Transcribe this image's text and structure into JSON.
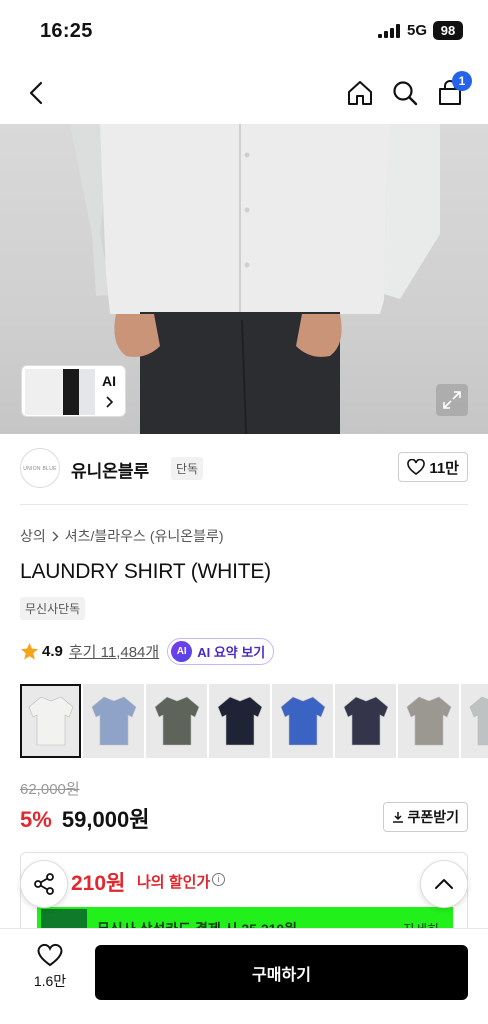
{
  "status_bar": {
    "time": "16:25",
    "network": "5G",
    "battery": "98"
  },
  "nav": {
    "cart_count": "1"
  },
  "hero": {
    "ai_label": "AI"
  },
  "brand": {
    "logo_text": "UNION BLUE",
    "name": "유니온블루",
    "tag": "단독",
    "like_count": "11만"
  },
  "breadcrumb": {
    "level1": "상의",
    "level2": "셔츠/블라우스 (유니온블루)"
  },
  "product": {
    "title": "LAUNDRY SHIRT (WHITE)",
    "exclusive_tag": "무신사단독"
  },
  "rating": {
    "score": "4.9",
    "reviews": "후기 11,484개",
    "ai_badge": "AI",
    "ai_summary": "AI 요약 보기"
  },
  "swatches": [
    {
      "color": "#f2f2f0"
    },
    {
      "color": "#8fa3c8"
    },
    {
      "color": "#5e6459"
    },
    {
      "color": "#1e2335"
    },
    {
      "color": "#3a63c4"
    },
    {
      "color": "#34344a"
    },
    {
      "color": "#9a9891"
    },
    {
      "color": "#bfc2c2"
    }
  ],
  "price": {
    "original": "62,000원",
    "discount": "5%",
    "final": "59,000원",
    "coupon_label": "쿠폰받기"
  },
  "benefit": {
    "amount": "210원",
    "label": "나의 할인가",
    "banner_text": "무신사 삼성카드 결제 시 25,210원",
    "banner_link": "자세히"
  },
  "bottom_bar": {
    "like_count": "1.6만",
    "buy_label": "구매하기"
  },
  "colors": {
    "accent_red": "#e0282e",
    "badge_blue": "#2563eb",
    "promo_green": "#22f01a"
  }
}
